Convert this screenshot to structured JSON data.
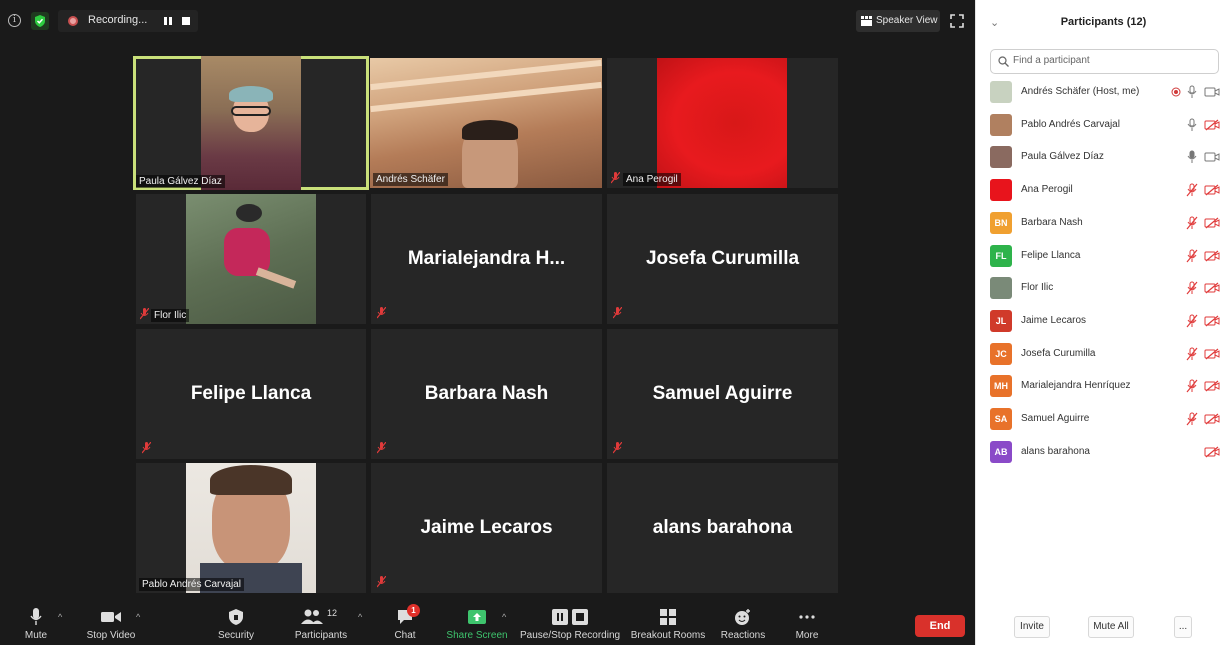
{
  "topbar": {
    "recording_label": "Recording...",
    "speaker_view_label": "Speaker View"
  },
  "tiles": [
    {
      "name": "Paula Gálvez Díaz",
      "has_video": true
    },
    {
      "name": "Andrés Schäfer",
      "has_video": true
    },
    {
      "name": "Ana Perogil",
      "has_video": true
    },
    {
      "name": "Flor Ilic",
      "has_video": true
    },
    {
      "name": "Marialejandra  H...",
      "has_video": false
    },
    {
      "name": "Josefa Curumilla",
      "has_video": false
    },
    {
      "name": "Felipe Llanca",
      "has_video": false
    },
    {
      "name": "Barbara Nash",
      "has_video": false
    },
    {
      "name": "Samuel Aguirre",
      "has_video": false
    },
    {
      "name": "Pablo Andrés Carvajal",
      "has_video": true
    },
    {
      "name": "Jaime Lecaros",
      "has_video": false
    },
    {
      "name": "alans barahona",
      "has_video": false
    }
  ],
  "toolbar": {
    "mute": "Mute",
    "stop_video": "Stop Video",
    "security": "Security",
    "participants": "Participants",
    "participants_count": "12",
    "chat": "Chat",
    "chat_badge": "1",
    "share_screen": "Share Screen",
    "pause_recording": "Pause/Stop Recording",
    "breakout_rooms": "Breakout Rooms",
    "reactions": "Reactions",
    "more": "More",
    "end": "End"
  },
  "panel": {
    "title": "Participants (12)",
    "search_placeholder": "Find a participant",
    "invite": "Invite",
    "mute_all": "Mute All",
    "more": "...",
    "participants": [
      {
        "name": "Andrés Schäfer (Host, me)",
        "initials": "",
        "avatar_color": "#c8d2c0",
        "recording": true,
        "mic": "on",
        "cam": "on"
      },
      {
        "name": "Pablo Andrés Carvajal",
        "initials": "",
        "avatar_color": "#b08060",
        "recording": false,
        "mic": "on",
        "cam": "off"
      },
      {
        "name": "Paula Gálvez Díaz",
        "initials": "",
        "avatar_color": "#8a6a60",
        "recording": false,
        "mic": "active",
        "cam": "on"
      },
      {
        "name": "Ana Perogil",
        "initials": "",
        "avatar_color": "#e8141c",
        "recording": false,
        "mic": "muted",
        "cam": "off"
      },
      {
        "name": "Barbara Nash",
        "initials": "BN",
        "avatar_color": "#f0a030",
        "recording": false,
        "mic": "muted",
        "cam": "off"
      },
      {
        "name": "Felipe Llanca",
        "initials": "FL",
        "avatar_color": "#2eb34b",
        "recording": false,
        "mic": "muted",
        "cam": "off"
      },
      {
        "name": "Flor Ilic",
        "initials": "",
        "avatar_color": "#7a8a78",
        "recording": false,
        "mic": "muted",
        "cam": "off"
      },
      {
        "name": "Jaime Lecaros",
        "initials": "JL",
        "avatar_color": "#d03a2a",
        "recording": false,
        "mic": "muted",
        "cam": "off"
      },
      {
        "name": "Josefa Curumilla",
        "initials": "JC",
        "avatar_color": "#e8722a",
        "recording": false,
        "mic": "muted",
        "cam": "off"
      },
      {
        "name": "Marialejandra Henríquez",
        "initials": "MH",
        "avatar_color": "#e8722a",
        "recording": false,
        "mic": "muted",
        "cam": "off"
      },
      {
        "name": "Samuel Aguirre",
        "initials": "SA",
        "avatar_color": "#e8722a",
        "recording": false,
        "mic": "muted",
        "cam": "off"
      },
      {
        "name": "alans barahona",
        "initials": "AB",
        "avatar_color": "#8a4ac8",
        "recording": false,
        "mic": "none",
        "cam": "off"
      }
    ]
  }
}
